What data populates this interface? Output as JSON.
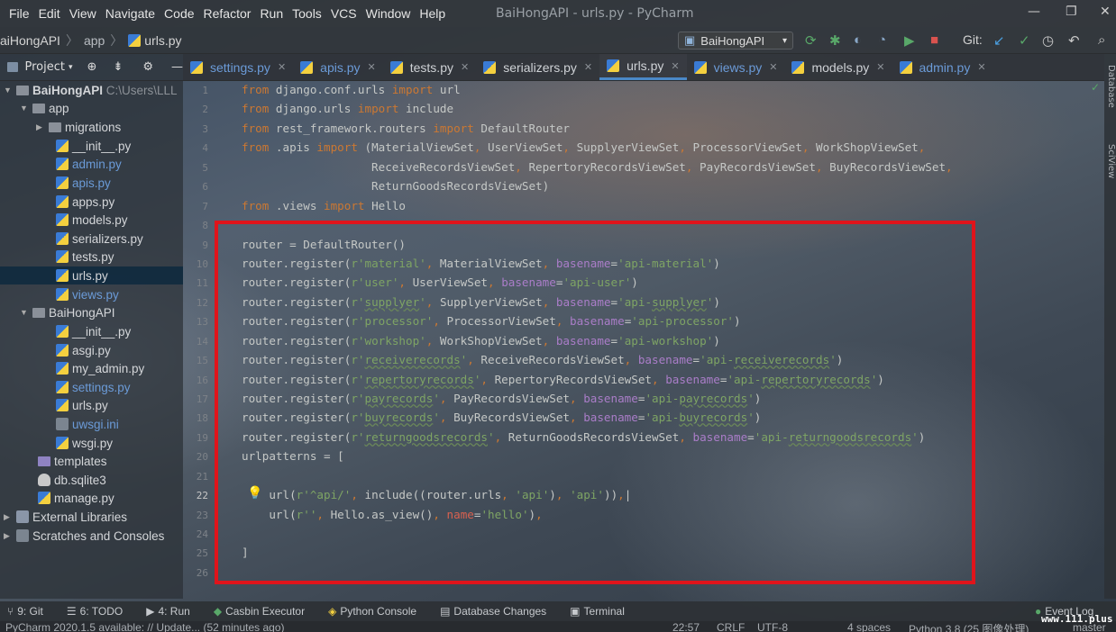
{
  "menu": [
    "File",
    "Edit",
    "View",
    "Navigate",
    "Code",
    "Refactor",
    "Run",
    "Tools",
    "VCS",
    "Window",
    "Help"
  ],
  "window_title": "BaiHongAPI - urls.py - PyCharm",
  "window_controls": {
    "minimize": "—",
    "restore": "❐",
    "close": "✕"
  },
  "breadcrumb": {
    "project": "aiHongAPI",
    "folder": "app",
    "file": "urls.py",
    "sep": "〉"
  },
  "run_config": {
    "label": "BaiHongAPI",
    "arrow": "▾"
  },
  "toolbar": {
    "git_label": "Git:"
  },
  "sidebar": {
    "header": "Project",
    "items": [
      {
        "label": "BaiHongAPI",
        "suffix": "C:\\Users\\LLL"
      },
      {
        "label": "app"
      },
      {
        "label": "migrations"
      },
      {
        "label": "__init__.py"
      },
      {
        "label": "admin.py"
      },
      {
        "label": "apis.py"
      },
      {
        "label": "apps.py"
      },
      {
        "label": "models.py"
      },
      {
        "label": "serializers.py"
      },
      {
        "label": "tests.py"
      },
      {
        "label": "urls.py"
      },
      {
        "label": "views.py"
      },
      {
        "label": "BaiHongAPI"
      },
      {
        "label": "__init__.py"
      },
      {
        "label": "asgi.py"
      },
      {
        "label": "my_admin.py"
      },
      {
        "label": "settings.py"
      },
      {
        "label": "urls.py"
      },
      {
        "label": "uwsgi.ini"
      },
      {
        "label": "wsgi.py"
      },
      {
        "label": "templates"
      },
      {
        "label": "db.sqlite3"
      },
      {
        "label": "manage.py"
      },
      {
        "label": "External Libraries"
      },
      {
        "label": "Scratches and Consoles"
      }
    ]
  },
  "tabs": [
    {
      "label": "settings.py"
    },
    {
      "label": "apis.py"
    },
    {
      "label": "tests.py"
    },
    {
      "label": "serializers.py"
    },
    {
      "label": "urls.py",
      "active": true
    },
    {
      "label": "views.py"
    },
    {
      "label": "models.py"
    },
    {
      "label": "admin.py"
    }
  ],
  "tab_close": "✕",
  "line_numbers": [
    "1",
    "2",
    "3",
    "4",
    "5",
    "6",
    "7",
    "8",
    "9",
    "10",
    "11",
    "12",
    "13",
    "14",
    "15",
    "16",
    "17",
    "18",
    "19",
    "20",
    "21",
    "22",
    "23",
    "24",
    "25",
    "26"
  ],
  "right_panels": {
    "database": "Database",
    "sciview": "SciView"
  },
  "tool_windows": [
    {
      "label": "9: Git"
    },
    {
      "label": "6: TODO"
    },
    {
      "label": "4: Run"
    },
    {
      "label": "Casbin Executor"
    },
    {
      "label": "Python Console"
    },
    {
      "label": "Database Changes"
    },
    {
      "label": "Terminal"
    },
    {
      "label": "Event Log"
    }
  ],
  "status": {
    "message": "PyCharm 2020.1.5 available: // Update... (52 minutes ago)",
    "position": "22:57",
    "line_sep": "CRLF",
    "encoding": "UTF-8",
    "indent": "4 spaces",
    "interpreter": "Python 3.8 (25 图像处理)",
    "branch": "master"
  },
  "watermark": "www.111.plus",
  "colors": {
    "keyword": "#cc7832",
    "string": "#7ea464",
    "param": "#aa7dc8",
    "highlight_box": "#e0141b",
    "active_tab": "#4a88c7"
  }
}
